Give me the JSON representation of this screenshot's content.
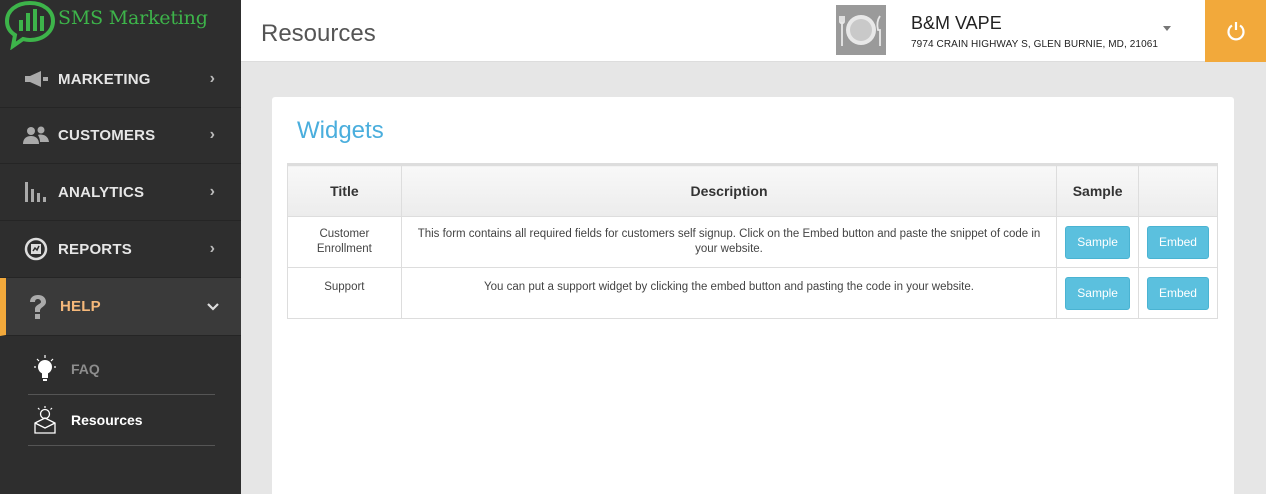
{
  "app": {
    "name": "SMS Marketing"
  },
  "sidebar": {
    "items": [
      {
        "label": "MARKETING",
        "icon": "megaphone-icon"
      },
      {
        "label": "CUSTOMERS",
        "icon": "users-icon"
      },
      {
        "label": "ANALYTICS",
        "icon": "bar-chart-icon"
      },
      {
        "label": "REPORTS",
        "icon": "report-icon"
      },
      {
        "label": "HELP",
        "icon": "question-icon",
        "active": true
      }
    ],
    "sub_items": [
      {
        "label": "FAQ",
        "icon": "lightbulb-icon"
      },
      {
        "label": "Resources",
        "icon": "resources-icon",
        "active": true
      }
    ]
  },
  "header": {
    "page_title": "Resources",
    "store_name": "B&M VAPE",
    "store_address": "7974 CRAIN HIGHWAY S, GLEN BURNIE, MD, 21061"
  },
  "widgets": {
    "title": "Widgets",
    "columns": [
      "Title",
      "Description",
      "Sample",
      ""
    ],
    "rows": [
      {
        "title": "Customer Enrollment",
        "description": "This form contains all required fields for customers self signup. Click on the Embed button and paste the snippet of code in your website.",
        "sample_label": "Sample",
        "embed_label": "Embed"
      },
      {
        "title": "Support",
        "description": "You can put a support widget by clicking the embed button and pasting the code in your website.",
        "sample_label": "Sample",
        "embed_label": "Embed"
      }
    ]
  },
  "colors": {
    "accent": "#f2a93b",
    "brand_green": "#3db44a",
    "link_blue": "#4aaedd",
    "button_blue": "#5bc0de",
    "sidebar_bg": "#2e2e2e"
  }
}
